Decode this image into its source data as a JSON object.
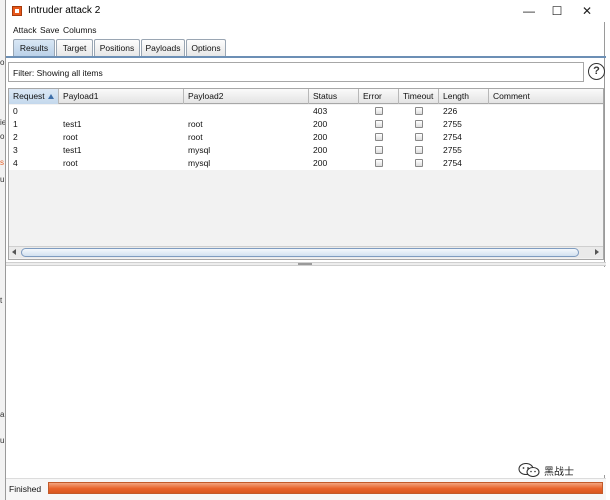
{
  "window": {
    "title": "Intruder attack 2",
    "controls": {
      "minimize": "—",
      "maximize": "☐",
      "close": "✕"
    }
  },
  "background_fragments": [
    "o",
    "ie",
    "o",
    "u",
    "s",
    "t",
    "a",
    "ul"
  ],
  "menu": [
    "Attack",
    "Save",
    "Columns"
  ],
  "tabs": [
    {
      "label": "Results",
      "active": true
    },
    {
      "label": "Target",
      "active": false
    },
    {
      "label": "Positions",
      "active": false
    },
    {
      "label": "Payloads",
      "active": false
    },
    {
      "label": "Options",
      "active": false
    }
  ],
  "filter": {
    "text": "Filter: Showing all items",
    "help_icon": "question-icon",
    "help_glyph": "?"
  },
  "table": {
    "columns": [
      "Request",
      "Payload1",
      "Payload2",
      "Status",
      "Error",
      "Timeout",
      "Length",
      "Comment"
    ],
    "sorted_column": "Request",
    "sort_direction": "ascending",
    "rows": [
      {
        "request": "0",
        "payload1": "",
        "payload2": "",
        "status": "403",
        "error": false,
        "timeout": false,
        "length": "226",
        "comment": ""
      },
      {
        "request": "1",
        "payload1": "test1",
        "payload2": "root",
        "status": "200",
        "error": false,
        "timeout": false,
        "length": "2755",
        "comment": ""
      },
      {
        "request": "2",
        "payload1": "root",
        "payload2": "root",
        "status": "200",
        "error": false,
        "timeout": false,
        "length": "2754",
        "comment": ""
      },
      {
        "request": "3",
        "payload1": "test1",
        "payload2": "mysql",
        "status": "200",
        "error": false,
        "timeout": false,
        "length": "2755",
        "comment": ""
      },
      {
        "request": "4",
        "payload1": "root",
        "payload2": "mysql",
        "status": "200",
        "error": false,
        "timeout": false,
        "length": "2754",
        "comment": ""
      }
    ]
  },
  "status": {
    "label": "Finished",
    "progress_percent": 100,
    "colors": {
      "progress": "#e8632a",
      "selected_tab": "#b9d0e8"
    }
  },
  "watermark": {
    "text": "黑战士",
    "icon": "wechat-icon"
  }
}
